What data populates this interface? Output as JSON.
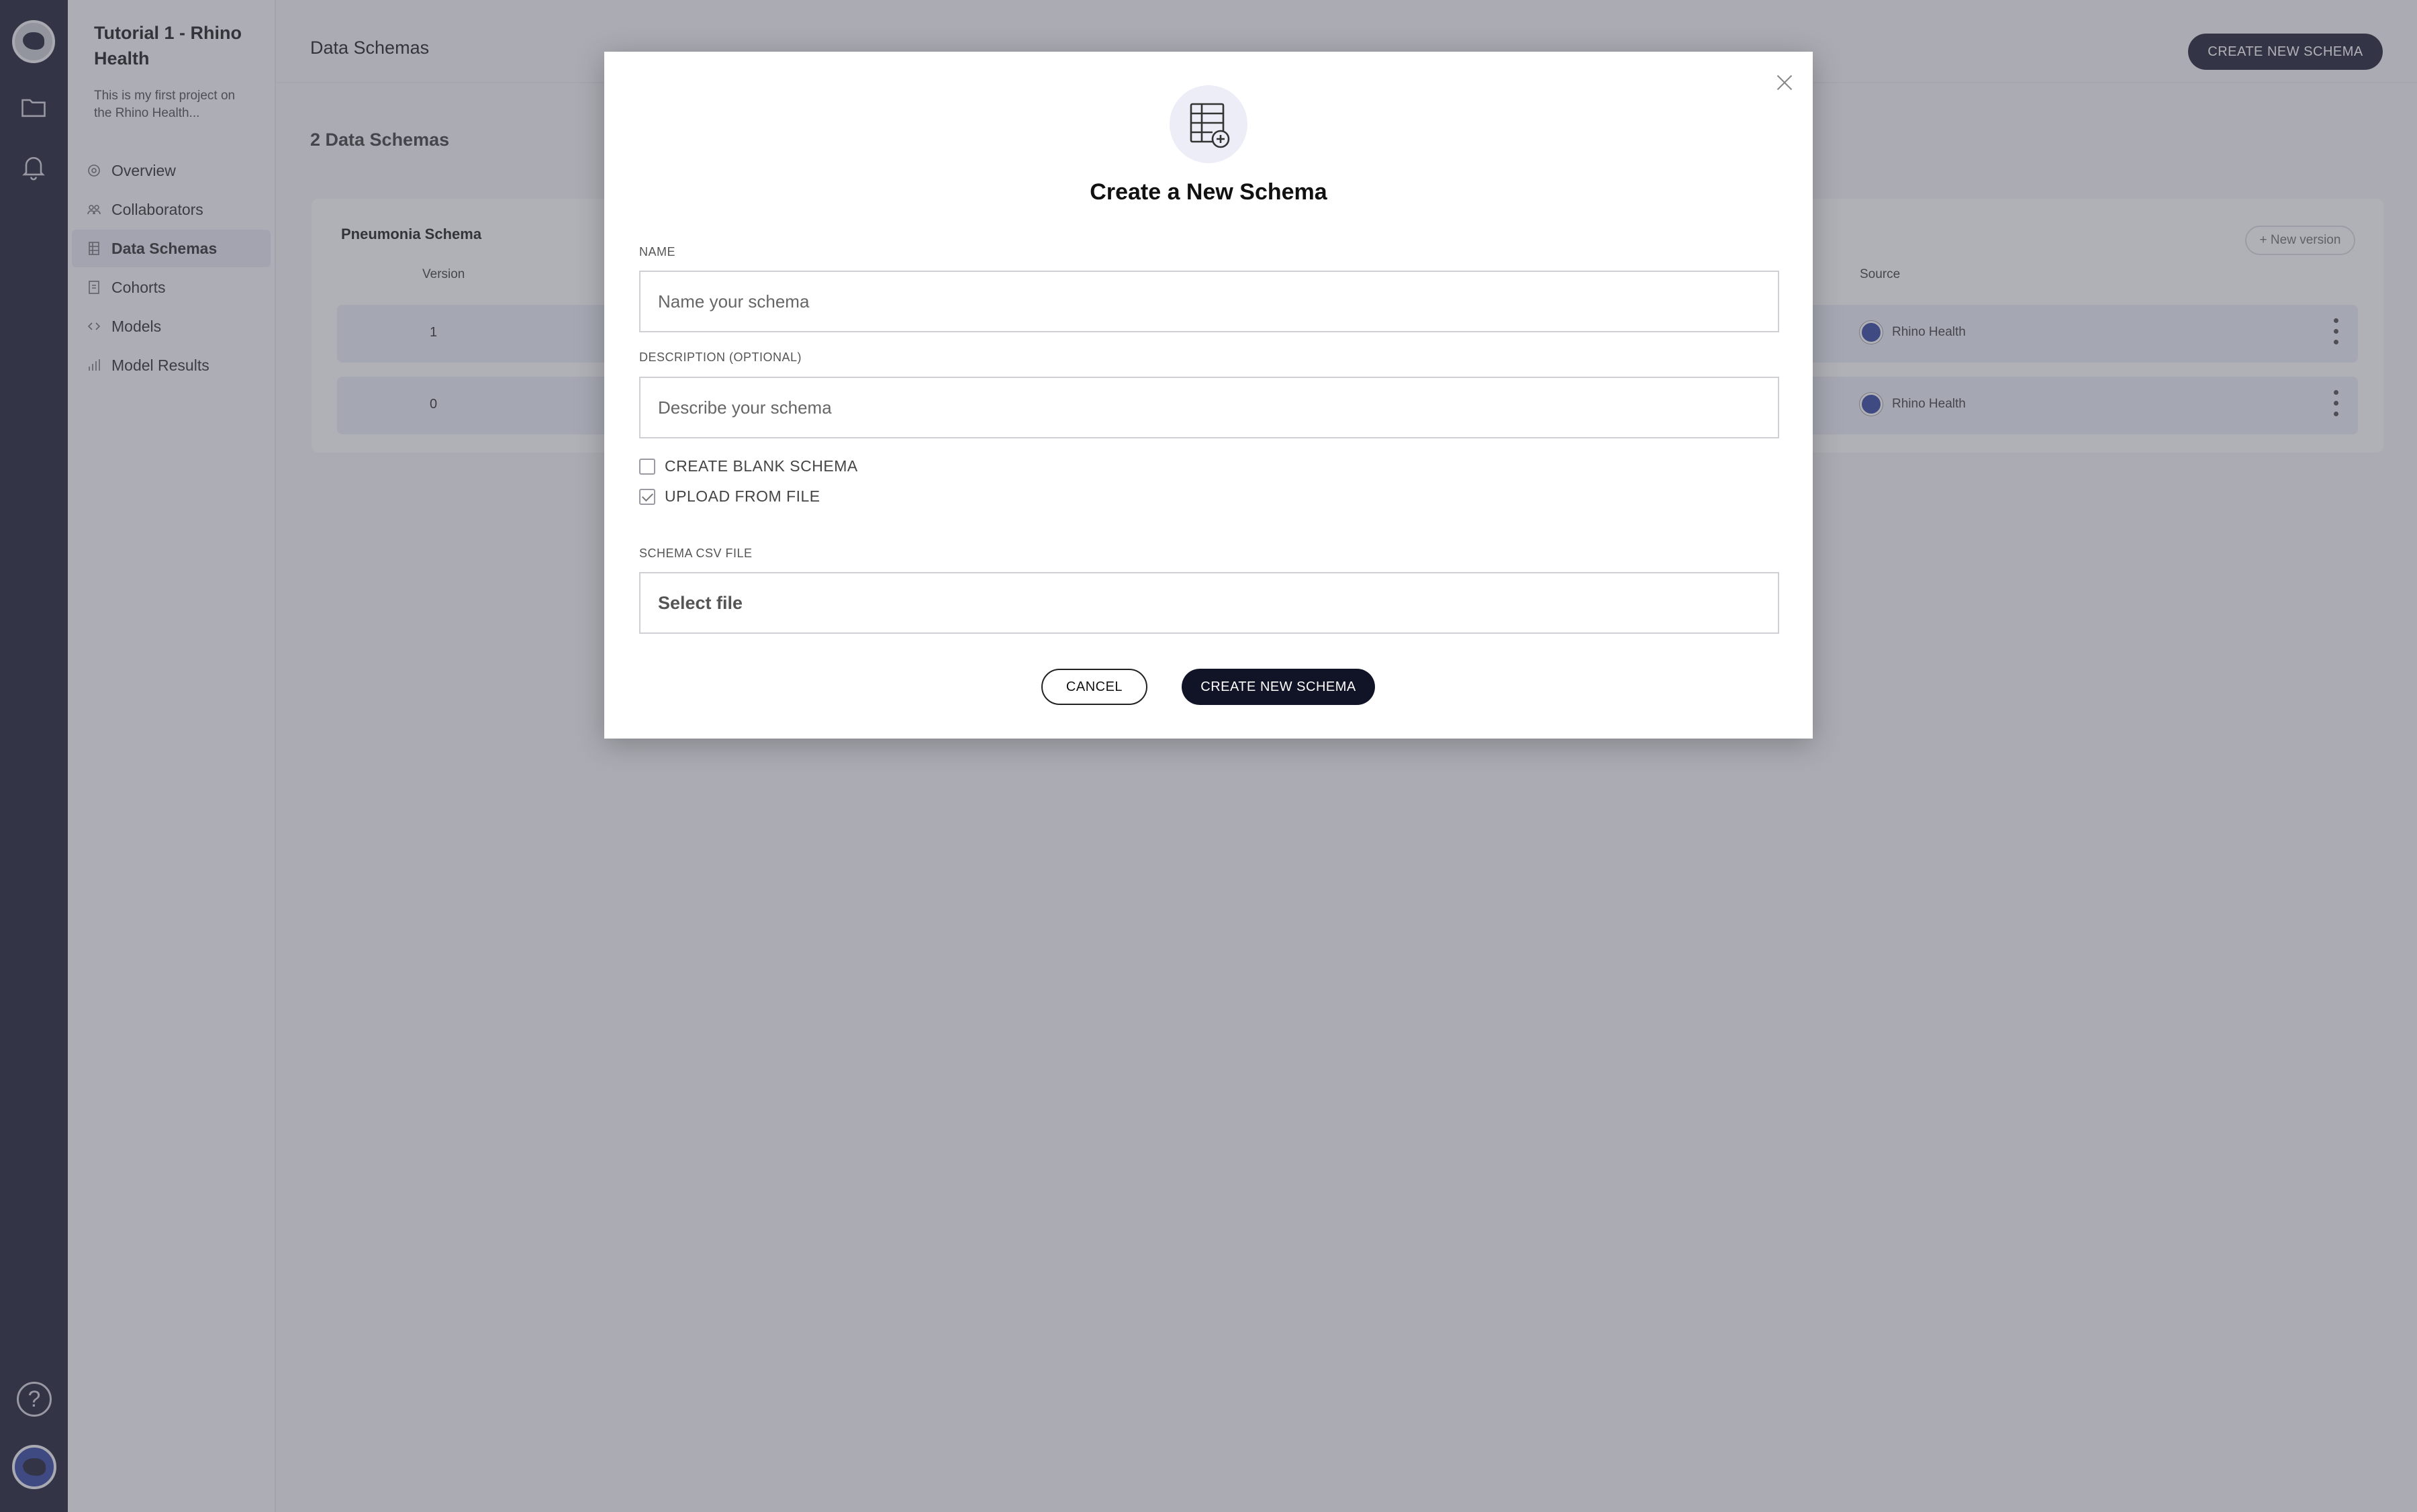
{
  "rail": {
    "icons": [
      "rhino-logo-icon",
      "folder-icon",
      "bell-icon",
      "help-icon",
      "user-avatar-icon"
    ],
    "help_glyph": "?"
  },
  "project": {
    "title": "Tutorial 1 - Rhino Health",
    "description": "This is my first project on the Rhino Health..."
  },
  "nav": {
    "items": [
      {
        "label": "Overview",
        "icon": "overview-icon"
      },
      {
        "label": "Collaborators",
        "icon": "collaborators-icon"
      },
      {
        "label": "Data Schemas",
        "icon": "data-schemas-icon",
        "active": true
      },
      {
        "label": "Cohorts",
        "icon": "cohorts-icon"
      },
      {
        "label": "Models",
        "icon": "code-icon"
      },
      {
        "label": "Model Results",
        "icon": "bar-chart-icon"
      }
    ]
  },
  "main": {
    "page_title": "Data Schemas",
    "create_button": "CREATE NEW SCHEMA",
    "count_label": "2 Data Schemas",
    "card": {
      "title": "Pneumonia Schema",
      "new_version_label": "+ New version",
      "columns": [
        "Version",
        "Source"
      ],
      "rows": [
        {
          "version": "1",
          "source": "Rhino Health"
        },
        {
          "version": "0",
          "source": "Rhino Health"
        }
      ]
    }
  },
  "modal": {
    "title": "Create a New Schema",
    "name_label": "NAME",
    "name_placeholder": "Name your schema",
    "description_label": "DESCRIPTION (OPTIONAL)",
    "description_placeholder": "Describe your schema",
    "options": [
      {
        "label": "CREATE BLANK SCHEMA",
        "checked": false
      },
      {
        "label": "UPLOAD FROM FILE",
        "checked": true
      }
    ],
    "file_label": "SCHEMA CSV FILE",
    "file_placeholder": "Select file",
    "cancel_label": "CANCEL",
    "create_label": "CREATE NEW SCHEMA"
  },
  "colors": {
    "navy": "#111327",
    "accent_row": "#eaebf5"
  }
}
